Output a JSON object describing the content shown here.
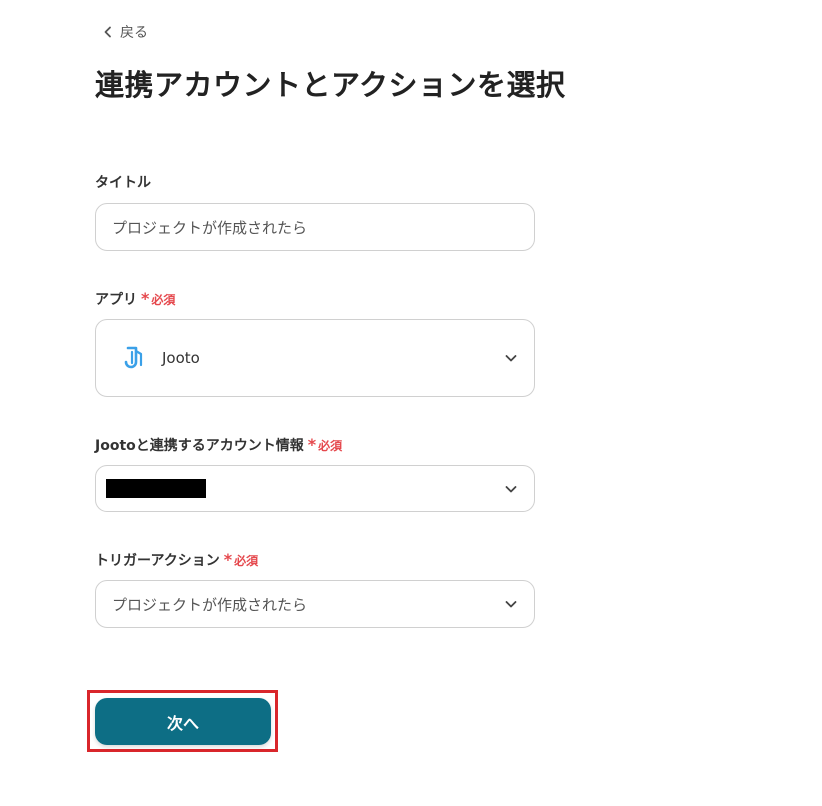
{
  "back_link": {
    "label": "戻る"
  },
  "page_title": "連携アカウントとアクションを選択",
  "title_field": {
    "label": "タイトル",
    "value": "プロジェクトが作成されたら"
  },
  "app_field": {
    "label": "アプリ",
    "required": "必須",
    "value": "Jooto",
    "icon": "jooto-logo-icon"
  },
  "account_field": {
    "label": "Jootoと連携するアカウント情報",
    "required": "必須"
  },
  "trigger_field": {
    "label": "トリガーアクション",
    "required": "必須",
    "value": "プロジェクトが作成されたら"
  },
  "next_button": {
    "label": "次へ"
  },
  "colors": {
    "primary": "#0d6e85",
    "required": "#e5484d",
    "highlight": "#d9262b",
    "jooto_icon": "#3aa0e8"
  }
}
